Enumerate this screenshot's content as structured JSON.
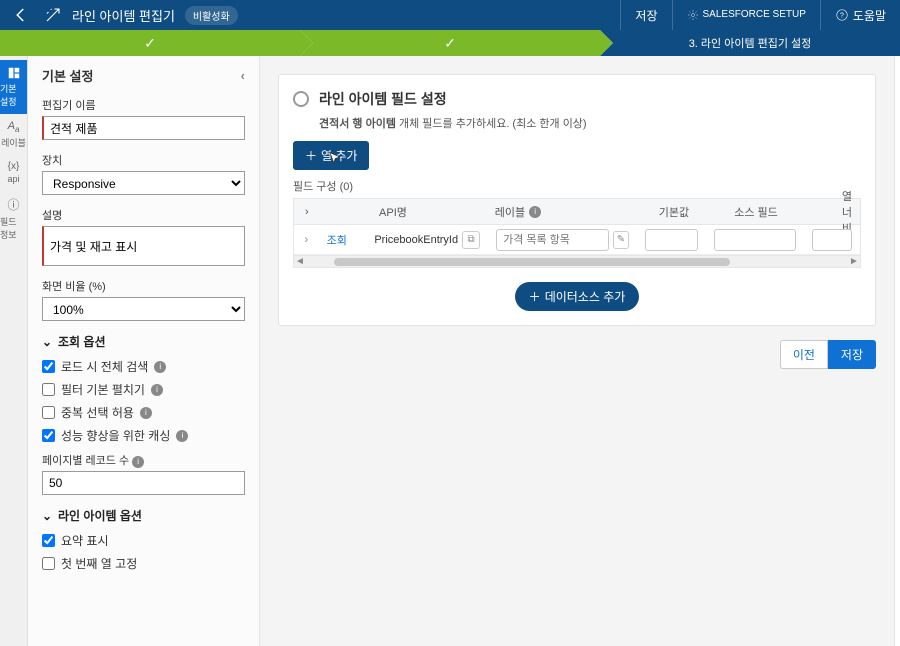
{
  "topbar": {
    "title": "라인 아이템 편집기",
    "status_pill": "비활성화",
    "save_label": "저장",
    "setup_label": "SALESFORCE SETUP",
    "help_label": "도움말"
  },
  "progress": {
    "step3_label": "3. 라인 아이템 편집기 설정"
  },
  "rail": {
    "items": [
      {
        "label": "기본 설정"
      },
      {
        "label": "레이블"
      },
      {
        "label": "api"
      },
      {
        "label": "필드 정보"
      }
    ]
  },
  "sidebar": {
    "header": "기본 설정",
    "editor_name_label": "편집기 이름",
    "editor_name_value": "견적 제품",
    "device_label": "장치",
    "device_value": "Responsive",
    "desc_label": "설명",
    "desc_value": "가격 및 재고 표시",
    "ratio_label": "화면 비율 (%)",
    "ratio_value": "100%",
    "query_section": "조회 옵션",
    "q1": "로드 시 전체 검색",
    "q2": "필터 기본 펼치기",
    "q3": "중복 선택 허용",
    "q4": "성능 향상을 위한 캐싱",
    "records_label": "페이지별 레코드 수",
    "records_value": "50",
    "line_section": "라인 아이템 옵션",
    "l1": "요약 표시",
    "l2": "첫 번째 열 고정"
  },
  "main": {
    "card_title": "라인 아이템 필드 설정",
    "card_sub_obj": "견적서 행 아이템",
    "card_sub_rest": " 개체 필드를 추가하세요. (최소 한개 이상)",
    "add_col": "열 추가",
    "grid_label": "필드 구성 (0)",
    "columns": {
      "api": "API명",
      "label": "레이블",
      "default": "기본값",
      "source": "소스 필드",
      "width": "열 너비"
    },
    "row1": {
      "action": "조회",
      "api": "PricebookEntryId",
      "label_placeholder": "가격 목록 항목"
    },
    "add_ds": "데이터소스 추가",
    "prev": "이전",
    "save": "저장"
  }
}
